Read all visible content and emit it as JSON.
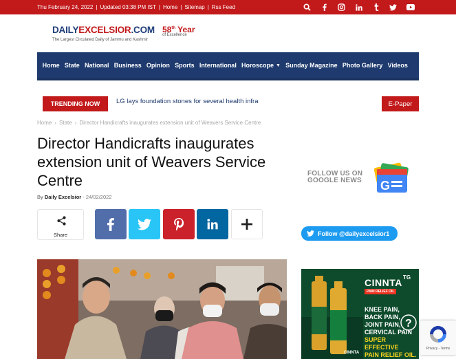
{
  "topbar": {
    "date": "Thu February 24, 2022",
    "updated": "Updated 03:38 PM IST",
    "links": [
      "Home",
      "Sitemap",
      "Rss Feed"
    ],
    "icons": [
      "search-icon",
      "facebook-icon",
      "instagram-icon",
      "linkedin-icon",
      "tumblr-icon",
      "twitter-icon",
      "youtube-icon"
    ]
  },
  "logo": {
    "name_part1": "DAILY",
    "name_part2": "EXCELSIOR",
    "name_part3": ".COM",
    "tagline": "The Largest Circulated Daily of Jammu and Kashmir",
    "anniversary_number": "58",
    "anniversary_suffix": "th",
    "anniversary_word": "Year",
    "anniversary_sub": "of Excellence"
  },
  "nav": {
    "items": [
      "Home",
      "State",
      "National",
      "Business",
      "Opinion",
      "Sports",
      "International",
      "Horoscope",
      "Sunday Magazine",
      "Photo Gallery",
      "Videos"
    ]
  },
  "trending": {
    "label": "TRENDING NOW",
    "headline": "LG lays foundation stones for several health infra",
    "epaper": "E-Paper"
  },
  "breadcrumb": {
    "items": [
      "Home",
      "State",
      "Director Handicrafts inaugurates extension unit of Weavers Service Centre"
    ],
    "separator": "›"
  },
  "article": {
    "title": "Director Handicrafts inaugurates extension unit of Weavers Service Centre",
    "by_label": "By",
    "author": "Daily Excelsior",
    "date_sep": "-",
    "date": "24/02/2022"
  },
  "share": {
    "label": "Share"
  },
  "sidebar": {
    "gnews_line1": "FOLLOW US ON",
    "gnews_line2": "GOOGLE NEWS",
    "twitter_follow": "Follow @dailyexcelsior1"
  },
  "ad": {
    "brand": "CINNTA",
    "sub": "PAIN RELIEF OIL",
    "tag": "TG",
    "lines": [
      "KNEE PAIN,",
      "BACK PAIN,",
      "JOINT PAIN,",
      "CERVICAL PAIN"
    ],
    "highlight": [
      "SUPER EFFECTIVE",
      "PAIN RELIEF OIL."
    ]
  },
  "recaptcha": {
    "links": "Privacy - Terms"
  },
  "colors": {
    "brand_red": "#c2191b",
    "nav_blue": "#1e3a6e",
    "facebook": "#516eab",
    "twitter": "#29c5f6",
    "pinterest": "#ca212a",
    "linkedin": "#0266a0"
  }
}
